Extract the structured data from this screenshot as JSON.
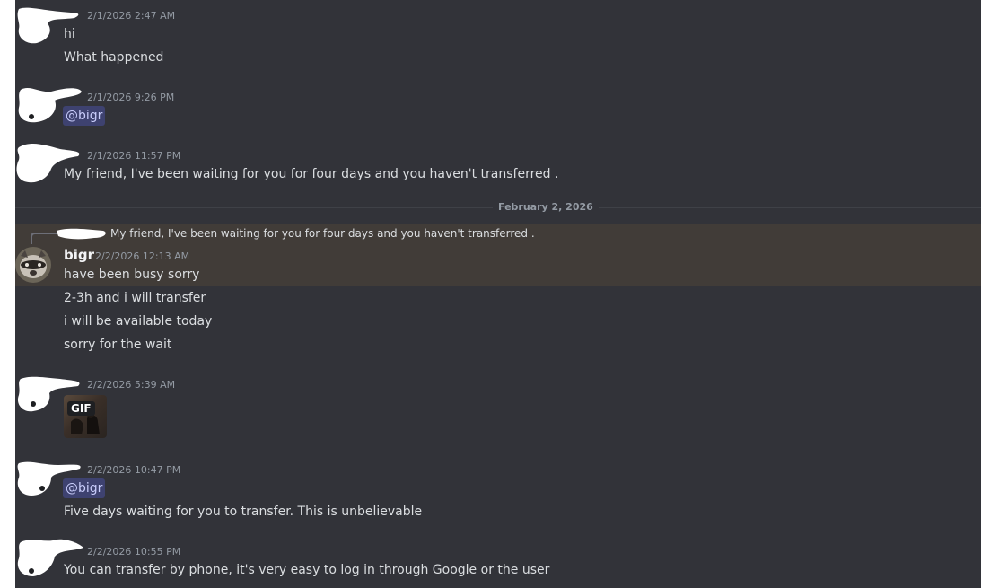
{
  "date_divider": "February 2, 2026",
  "messages": [
    {
      "timestamp": "2/1/2026 2:47 AM",
      "lines": [
        "hi",
        "What happened"
      ]
    },
    {
      "timestamp": "2/1/2026 9:26 PM",
      "mention": "@bigr"
    },
    {
      "timestamp": "2/1/2026 11:57 PM",
      "lines": [
        "My friend, I've been waiting for you for four days and you haven't transferred ."
      ]
    },
    {
      "reply_preview": "My friend, I've been waiting for you for four days and you haven't transferred .",
      "username": "bigr",
      "timestamp": "2/2/2026 12:13 AM",
      "lines": [
        "have been busy sorry",
        "2-3h and i will transfer",
        "i will be available today",
        "sorry for the wait"
      ]
    },
    {
      "timestamp": "2/2/2026 5:39 AM",
      "gif_label": "GIF"
    },
    {
      "timestamp": "2/2/2026 10:47 PM",
      "mention": "@bigr",
      "lines": [
        "Five days waiting for you to transfer. This is unbelievable"
      ]
    },
    {
      "timestamp": "2/2/2026 10:55 PM",
      "lines": [
        "You can transfer by phone, it's very easy to log in through Google or the user"
      ]
    }
  ],
  "colors": {
    "chat_background": "#323339",
    "highlight_background": "#413c38",
    "mention_background": "#3e4270",
    "mention_text": "#c9cdfb"
  }
}
